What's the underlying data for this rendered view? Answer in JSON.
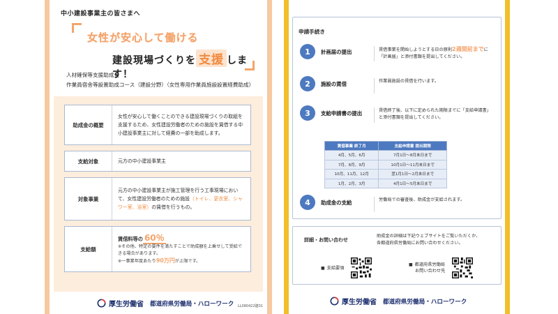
{
  "colors": {
    "stripe_left": "#f6c99f",
    "stripe_right": "#f2bf2a",
    "accent_orange": "#f08a3e",
    "step_blue": "#4d79c0",
    "ministry_navy": "#1d2f6f"
  },
  "left": {
    "addressee": "中小建設事業主の皆さまへ",
    "headline1": "女性が安心して働ける",
    "headline2_pre": "建設現場づくりを",
    "headline2_hl": "支援",
    "headline2_post": "します！",
    "grant_line1": "人材確保等支援助成金",
    "grant_line2": "作業員宿舎等設置助成コース（建設分野）（女性専用作業員施設設置経費助成）",
    "overview": {
      "label": "助成金の概要",
      "text": "女性が安心して働くことのできる建設現場づくりの取組を支援するため、女性建設労働者のための施設を賃借する中小建設事業主に対して経費の一部を助成します。"
    },
    "target_employer": {
      "label": "支給対象",
      "text": "元方の中小建設事業主"
    },
    "target_project": {
      "label": "対象事業",
      "text_pre": "元方の中小建設事業主が施工管理を行う工事現場において、女性建設労働者のための施設",
      "text_hl": "（トイレ、更衣室、シャワー室、浴室）",
      "text_post": "の賃借を行うもの。"
    },
    "amount": {
      "label": "支給額",
      "rate_pre": "賃借料等の",
      "rate_pct": "60％",
      "note1": "※その他、特定の要件を満たすことで助成額を上乗せして受給できる場合があります。",
      "note2_pre": "※一事業年度あたり",
      "note2_amount": "90万円",
      "note2_post": "が上限です。"
    },
    "ministry": "厚生労働省",
    "bureau": "都道府県労働局・ハローワーク",
    "doc_code": "LL080422建01"
  },
  "right": {
    "steps_title": "申請手続き",
    "steps": [
      {
        "num": "1",
        "title": "計画届の提出",
        "desc_pre": "賃借事業を開始しようとする日の原則",
        "desc_hl": "2週間前まで",
        "desc_post": "に「計画届」と添付書類を提出してください。"
      },
      {
        "num": "2",
        "title": "施設の賃借",
        "desc": "作業員施設の賃借を行います。"
      },
      {
        "num": "3",
        "title": "支給申請書の提出",
        "desc": "賃借終了後、以下に定められた期限までに「支給申請書」と添付書類を提出してください。"
      },
      {
        "num": "4",
        "title": "助成金の支給",
        "desc": "労働局での審査後、助成金が支給されます。"
      }
    ],
    "schedule": {
      "headers": [
        "賃借事業 終了月",
        "支給申請書 提出期限"
      ],
      "rows": [
        [
          "4月、5月、6月",
          "7月1日〜8月末日まで"
        ],
        [
          "7月、8月、9月",
          "10月1日〜11月末日まで"
        ],
        [
          "10月、11月、12月",
          "翌1月1日〜2月末日まで"
        ],
        [
          "1月、2月、3月",
          "4月1日〜5月末日まで"
        ]
      ]
    },
    "contact": {
      "title": "詳細・お問い合わせ",
      "text_line1": "助成金の詳細は下記ウェブサイトをご覧いただくか、",
      "text_line2": "各都道府県労働局にお問い合わせください。",
      "qr1_label": "支給要領",
      "qr2_label_line1": "都道府県労働局",
      "qr2_label_line2": "お問い合わせ先",
      "bullet": "■"
    },
    "ministry": "厚生労働省",
    "bureau": "都道府県労働局・ハローワーク"
  }
}
